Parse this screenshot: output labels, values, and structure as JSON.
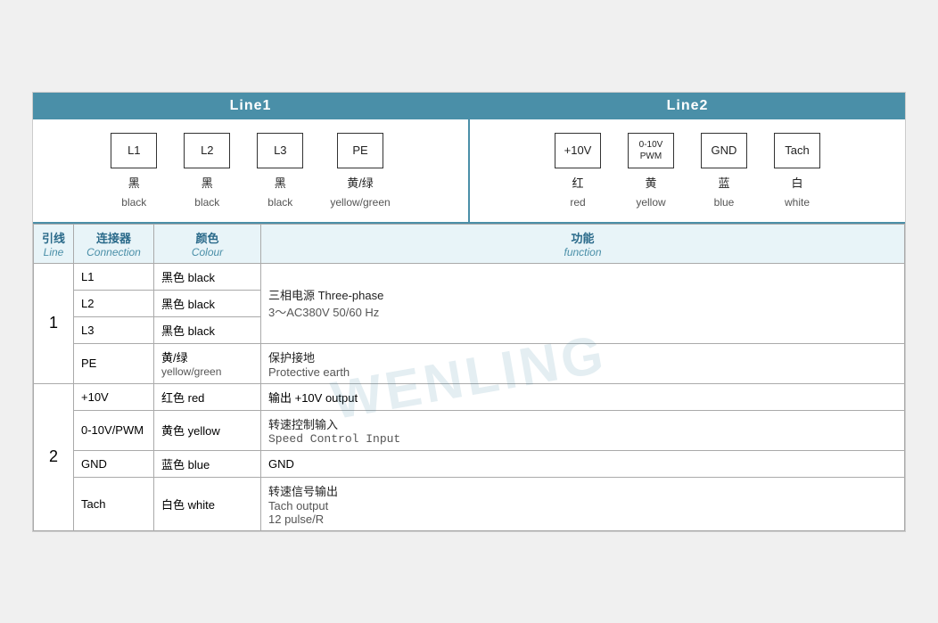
{
  "line1": {
    "header": "Line1",
    "connectors": [
      {
        "id": "L1",
        "cn": "黑",
        "en": "black"
      },
      {
        "id": "L2",
        "cn": "黑",
        "en": "black"
      },
      {
        "id": "L3",
        "cn": "黑",
        "en": "black"
      },
      {
        "id": "PE",
        "cn": "黄/绿",
        "en": "yellow/green"
      }
    ]
  },
  "line2": {
    "header": "Line2",
    "connectors": [
      {
        "id": "+10V",
        "cn": "红",
        "en": "red"
      },
      {
        "id": "0-10V\nPWM",
        "id_display": "0-10V PWM",
        "cn": "黄",
        "en": "yellow"
      },
      {
        "id": "GND",
        "cn": "蓝",
        "en": "blue"
      },
      {
        "id": "Tach",
        "cn": "白",
        "en": "white"
      }
    ]
  },
  "table": {
    "headers": {
      "line_cn": "引线",
      "line_en": "Line",
      "conn_cn": "连接器",
      "conn_en": "Connection",
      "color_cn": "颜色",
      "color_en": "Colour",
      "func_cn": "功能",
      "func_en": "function"
    },
    "rows_line1": [
      {
        "line": "1",
        "rowspan": 4,
        "entries": [
          {
            "conn": "L1",
            "color_cn": "黑色 black",
            "func_cn": "三相电源 Three-phase",
            "func_en": "3～AC380V 50/60 Hz",
            "func_rowspan": 3
          },
          {
            "conn": "L2",
            "color_cn": "黑色 black",
            "func_hidden": true
          },
          {
            "conn": "L3",
            "color_cn": "黑色 black",
            "func_hidden": true
          },
          {
            "conn": "PE",
            "color_cn": "黄/绿",
            "color_en": "yellow/green",
            "func_cn": "保护接地",
            "func_en": "Protective earth"
          }
        ]
      }
    ],
    "rows_line2": [
      {
        "line": "2",
        "rowspan": 4,
        "entries": [
          {
            "conn": "+10V",
            "color_cn": "红色 red",
            "func_cn": "输出 +10V output"
          },
          {
            "conn": "0-10V/PWM",
            "color_cn": "黄色 yellow",
            "func_cn": "转速控制输入",
            "func_en": "Speed Control Input",
            "func_monospace": true
          },
          {
            "conn": "GND",
            "color_cn": "蓝色 blue",
            "func_cn": "GND"
          },
          {
            "conn": "Tach",
            "color_cn": "白色 white",
            "func_cn": "转速信号输出",
            "func_en": "Tach output",
            "func_en2": "12 pulse/R"
          }
        ]
      }
    ],
    "watermark": "WENLING"
  }
}
